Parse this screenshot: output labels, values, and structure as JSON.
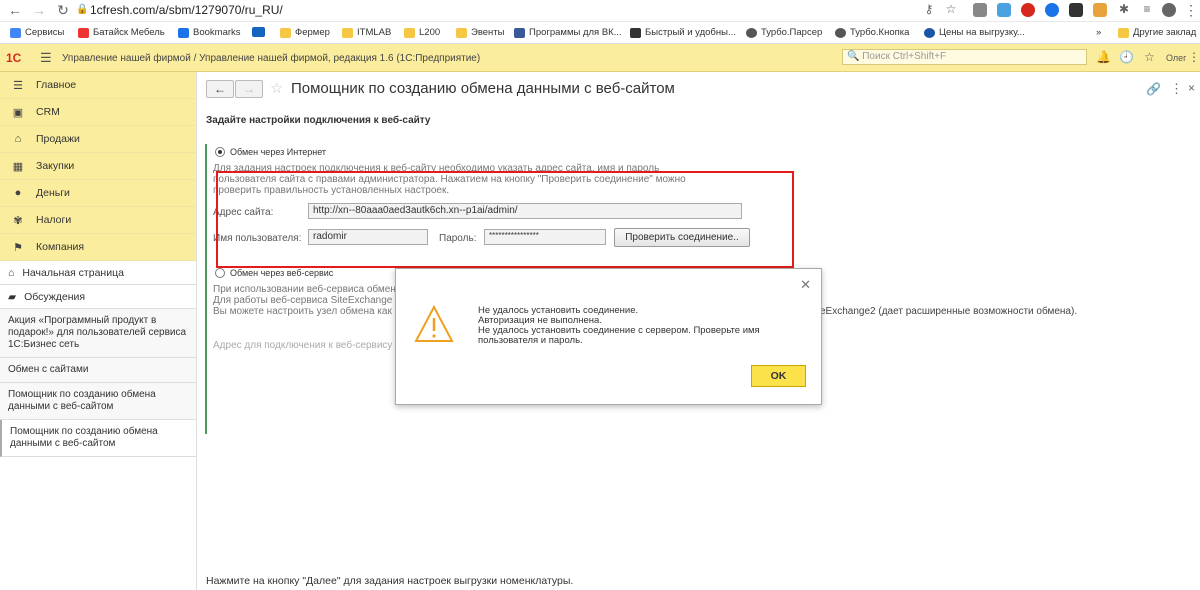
{
  "browser": {
    "url": "1cfresh.com/a/sbm/1279070/ru_RU/",
    "profile": "Олег",
    "bookmarks": [
      {
        "label": "Сервисы",
        "icon": "apps-icon"
      },
      {
        "label": "Батайск Мебель",
        "icon": "store-icon"
      },
      {
        "label": "Bookmarks",
        "icon": "star-icon"
      },
      {
        "label": "",
        "icon": "it-icon"
      },
      {
        "label": "Фермер",
        "icon": "folder-icon"
      },
      {
        "label": "ITMLAB",
        "icon": "folder-icon"
      },
      {
        "label": "L200",
        "icon": "folder-icon"
      },
      {
        "label": "Эвенты",
        "icon": "folder-icon"
      },
      {
        "label": "Программы для ВК...",
        "icon": "b-icon"
      },
      {
        "label": "Быстрый и удобны...",
        "icon": "v-icon"
      },
      {
        "label": "Турбо.Парсер",
        "icon": "globe-icon"
      },
      {
        "label": "Турбо.Кнопка",
        "icon": "globe-icon"
      },
      {
        "label": "Цены на выгрузку...",
        "icon": "sp-icon"
      }
    ],
    "more": "»",
    "other_bookmarks": "Другие заклад"
  },
  "app": {
    "logo": "1С",
    "title": "Управление нашей фирмой / Управление нашей фирмой, редакция 1.6  (1С:Предприятие)",
    "search_placeholder": "Поиск Ctrl+Shift+F",
    "user": "Олег"
  },
  "sidebar": {
    "sections": [
      {
        "label": "Главное",
        "icon": "menu-icon"
      },
      {
        "label": "CRM",
        "icon": "crm-icon"
      },
      {
        "label": "Продажи",
        "icon": "shop-icon"
      },
      {
        "label": "Закупки",
        "icon": "purchase-icon"
      },
      {
        "label": "Деньги",
        "icon": "money-icon"
      },
      {
        "label": "Налоги",
        "icon": "tax-icon"
      },
      {
        "label": "Компания",
        "icon": "flag-icon"
      }
    ],
    "home": "Начальная страница",
    "discussions": "Обсуждения",
    "open_windows": [
      "Акция «Программный продукт в подарок!» для пользователей сервиса 1С:Бизнес сеть",
      "Обмен с сайтами",
      "Помощник по созданию обмена данными с веб-сайтом",
      "Помощник по созданию обмена данными с веб-сайтом"
    ]
  },
  "form": {
    "title": "Помощник по созданию обмена данными с веб-сайтом",
    "section_header": "Задайте настройки подключения к веб-сайту",
    "option_internet": "Обмен через Интернет",
    "hint_internet": [
      "Для задания настроек подключения к веб-сайту необходимо указать адрес сайта, имя и пароль",
      "пользователя сайта с правами администратора. Нажатием на кнопку \"Проверить соединение\" можно",
      "проверить правильность установленных настроек."
    ],
    "site_label": "Адрес сайта:",
    "site_value": "http://xn--80aaa0aed3autk6ch.xn--p1ai/admin/",
    "user_label": "Имя пользователя:",
    "user_value": "radomir",
    "password_label": "Пароль:",
    "password_value": "****************",
    "check_button": "Проверить соединение..",
    "option_service": "Обмен через веб-сервис",
    "hint_service": [
      "При использовании веб-сервиса обмен",
      "Для работы веб-сервиса SiteExchange",
      "Вы можете настроить узел обмена как"
    ],
    "hint_service_tail": "eExchange2 (дает расширенные возможности обмена).",
    "service_address_label": "Адрес для подключения к веб-сервису",
    "footer": "Нажмите на кнопку \"Далее\" для задания настроек выгрузки номенклатуры."
  },
  "dialog": {
    "lines": [
      "Не удалось установить соединение.",
      "Авторизация не выполнена.",
      "Не удалось установить соединение с сервером. Проверьте имя",
      "пользователя и пароль."
    ],
    "ok": "OK"
  }
}
